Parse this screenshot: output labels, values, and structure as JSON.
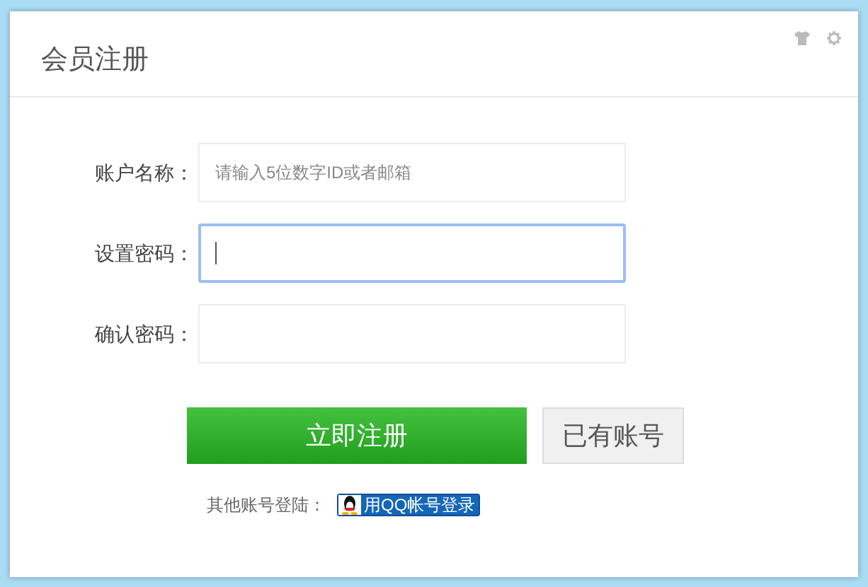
{
  "dialog": {
    "title": "会员注册"
  },
  "fields": [
    {
      "label": "账户名称：",
      "placeholder": "请输入5位数字ID或者邮箱",
      "focused": false
    },
    {
      "label": "设置密码：",
      "focused": true
    },
    {
      "label": "确认密码：",
      "focused": false
    }
  ],
  "buttons": [
    {
      "kind": "primary",
      "label": "立即注册"
    },
    {
      "kind": "secondary",
      "label": "已有账号"
    }
  ],
  "other_login": {
    "label": "其他账号登陆：",
    "qq_button": "用QQ帐号登录"
  }
}
